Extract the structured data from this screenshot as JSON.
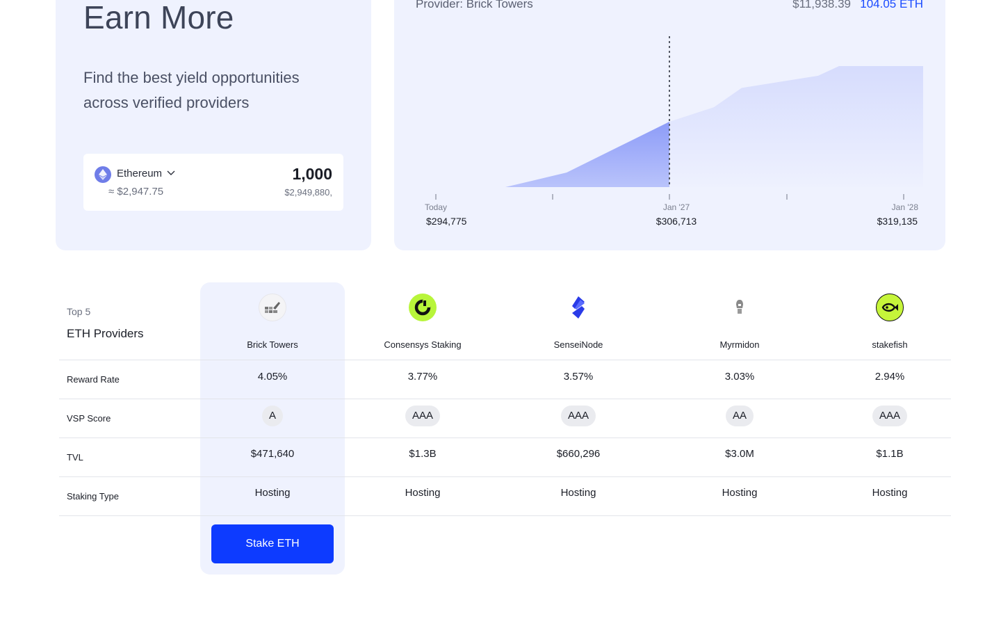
{
  "hero": {
    "title": "Earn More",
    "subtitle": "Find the best yield opportunities across verified providers"
  },
  "input": {
    "asset": "Ethereum",
    "asset_icon": "ethereum-icon",
    "asset_fiat": "≈ $2,947.75",
    "amount": "1,000",
    "amount_fiat": "$2,949,880,"
  },
  "projection": {
    "provider_label": "Provider: Brick Towers",
    "usd_total": "$11,938.39",
    "eth_total": "104.05 ETH",
    "accent": "#1a4bff"
  },
  "chart_data": {
    "type": "area",
    "x_labels": [
      "Today",
      "Jan '27",
      "Jan '28"
    ],
    "x_values": [
      "$294,775",
      "$306,713",
      "$319,135"
    ],
    "points": [
      0.0,
      0.0,
      0.12,
      0.37,
      0.54,
      0.66,
      0.82,
      0.92,
      1.0,
      1.0
    ],
    "marker_index": 4
  },
  "table": {
    "top_label": "Top 5",
    "top_title": "ETH Providers",
    "row_labels": [
      "Reward Rate",
      "VSP Score",
      "TVL",
      "Staking Type"
    ],
    "providers": [
      {
        "name": "Brick Towers",
        "icon": "brick-towers-icon",
        "reward": "4.05%",
        "vsp": "A",
        "tvl": "$471,640",
        "type": "Hosting"
      },
      {
        "name": "Consensys Staking",
        "icon": "consensys-icon",
        "reward": "3.77%",
        "vsp": "AAA",
        "tvl": "$1.3B",
        "type": "Hosting"
      },
      {
        "name": "SenseiNode",
        "icon": "senseinode-icon",
        "reward": "3.57%",
        "vsp": "AAA",
        "tvl": "$660,296",
        "type": "Hosting"
      },
      {
        "name": "Myrmidon",
        "icon": "myrmidon-icon",
        "reward": "3.03%",
        "vsp": "AA",
        "tvl": "$3.0M",
        "type": "Hosting"
      },
      {
        "name": "stakefish",
        "icon": "stakefish-icon",
        "reward": "2.94%",
        "vsp": "AAA",
        "tvl": "$1.1B",
        "type": "Hosting"
      }
    ],
    "cta": "Stake ETH",
    "cta_color": "#0d3bff"
  }
}
